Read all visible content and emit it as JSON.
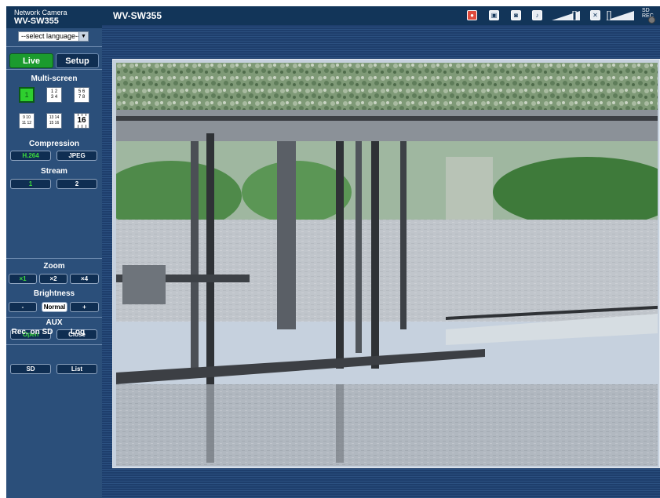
{
  "brand": {
    "small": "Network Camera",
    "model": "WV-SW355"
  },
  "header": {
    "title": "WV-SW355",
    "sd_rec": "SD REC"
  },
  "language": {
    "selected": "--select language--"
  },
  "nav": {
    "live": "Live",
    "setup": "Setup"
  },
  "multiscreen": {
    "title": "Multi-screen",
    "single": "1",
    "quad_a": [
      "1 2",
      "3 4"
    ],
    "quad_b": [
      "5 6",
      "7 8"
    ],
    "quad_c": [
      "9 10",
      "11 12"
    ],
    "quad_d": [
      "13 14",
      "15 16"
    ],
    "sixteen": "16"
  },
  "compression": {
    "title": "Compression",
    "h264": "H.264",
    "jpeg": "JPEG"
  },
  "stream": {
    "title": "Stream",
    "s1": "1",
    "s2": "2"
  },
  "zoom": {
    "title": "Zoom",
    "x1": "×1",
    "x2": "×2",
    "x4": "×4"
  },
  "brightness": {
    "title": "Brightness",
    "minus": "-",
    "normal": "Normal",
    "plus": "+"
  },
  "aux": {
    "title": "AUX",
    "open": "Open",
    "close": "Close"
  },
  "recsd": {
    "title": "Rec. on SD",
    "sd": "SD"
  },
  "log": {
    "title": "Log",
    "list": "List"
  },
  "colors": {
    "active_green": "#3ddc3d",
    "header_bg": "#123559",
    "sidebar_bg": "#2b4f7a"
  }
}
